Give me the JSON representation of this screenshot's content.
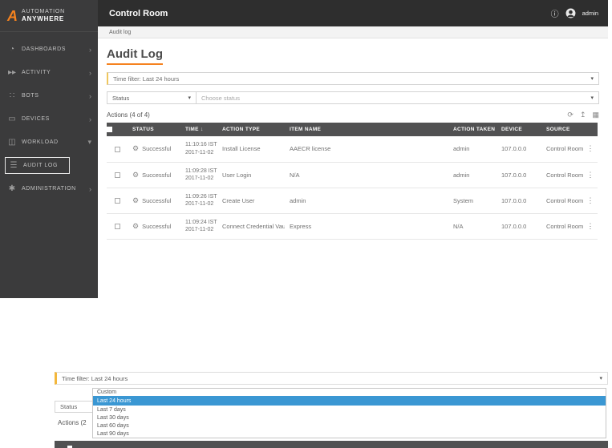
{
  "colors": {
    "accent_orange": "#f5821f",
    "sidebar_bg": "#3b3b3c",
    "topbar_bg": "#2e2e2e",
    "table_header_bg": "#515152",
    "selected_option_bg": "#3a97d3",
    "focus_border_yellow": "#f3b73c"
  },
  "topbar": {
    "title": "Control Room",
    "info_icon": "ⓘ",
    "user_label": "admin"
  },
  "sidebar": {
    "logo_mark": "A",
    "logo_line1": "AUTOMATION",
    "logo_line2": "ANYWHERE",
    "items": [
      {
        "label": "DASHBOARDS",
        "icon": "dashboards-icon",
        "glyph": "◔",
        "chevron": "›"
      },
      {
        "label": "ACTIVITY",
        "icon": "activity-icon",
        "glyph": "▸▸",
        "chevron": "›"
      },
      {
        "label": "BOTS",
        "icon": "bots-icon",
        "glyph": "∷",
        "chevron": "›"
      },
      {
        "label": "DEVICES",
        "icon": "devices-icon",
        "glyph": "▭",
        "chevron": "›"
      },
      {
        "label": "WORKLOAD",
        "icon": "workload-icon",
        "glyph": "◫",
        "chevron": "▾"
      },
      {
        "label": "AUDIT LOG",
        "icon": "audit-log-icon",
        "glyph": "☰",
        "chevron": ""
      },
      {
        "label": "ADMINISTRATION",
        "icon": "administration-icon",
        "glyph": "✱",
        "chevron": "›"
      }
    ]
  },
  "breadcrumb": "Audit log",
  "main": {
    "title": "Audit Log",
    "time_filter_value": "Time filter: Last 24 hours",
    "caret": "▾",
    "status_label": "Status",
    "status_placeholder": "Choose status",
    "actions_count": "Actions (4 of 4)",
    "toolbar_icons": {
      "refresh": "⟳",
      "export": "↥",
      "columns": "▦"
    },
    "table": {
      "headers": [
        "STATUS",
        "TIME",
        "ACTION TYPE",
        "ITEM NAME",
        "ACTION TAKEN BY",
        "DEVICE",
        "SOURCE"
      ],
      "sort_icon": "↓",
      "row_menu_icon": "⋮",
      "status_glyph": "⚙",
      "rows": [
        {
          "status": "Successful",
          "time_line1": "11:10:16 IST",
          "time_line2": "2017-11-02",
          "action_type": "Install License",
          "item_name": "AAECR license",
          "action_taken_by": "admin",
          "device": "107.0.0.0",
          "source": "Control Room"
        },
        {
          "status": "Successful",
          "time_line1": "11:09:28 IST",
          "time_line2": "2017-11-02",
          "action_type": "User Login",
          "item_name": "N/A",
          "action_taken_by": "admin",
          "device": "107.0.0.0",
          "source": "Control Room"
        },
        {
          "status": "Successful",
          "time_line1": "11:09:26 IST",
          "time_line2": "2017-11-02",
          "action_type": "Create User",
          "item_name": "admin",
          "action_taken_by": "System",
          "device": "107.0.0.0",
          "source": "Control Room"
        },
        {
          "status": "Successful",
          "time_line1": "11:09:24 IST",
          "time_line2": "2017-11-02",
          "action_type": "Connect Credential Vault",
          "item_name": "Express",
          "action_taken_by": "N/A",
          "device": "107.0.0.0",
          "source": "Control Room"
        }
      ]
    }
  },
  "dropdown_fragment": {
    "filter_value": "Time filter: Last 24 hours",
    "caret": "▾",
    "status_label": "Status",
    "actions_partial": "Actions (2",
    "options": [
      "Custom",
      "Last 24 hours",
      "Last 7 days",
      "Last 30 days",
      "Last 60 days",
      "Last 90 days"
    ],
    "selected_option": "Last 24 hours"
  }
}
